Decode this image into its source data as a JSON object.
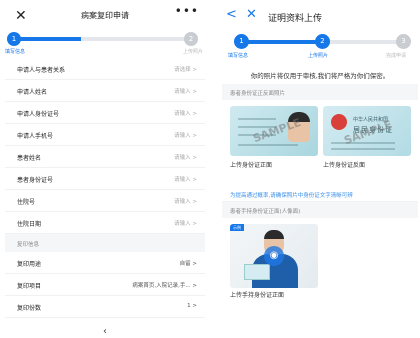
{
  "left": {
    "header": {
      "close": "✕",
      "title": "病案复印申请",
      "more": "•••"
    },
    "stepper": {
      "step1_num": "1",
      "step2_num": "2",
      "step1_label": "填写信息",
      "step2_label": "上传照片"
    },
    "rows": [
      {
        "label": "申请人与患者关系",
        "value": "请选择 >"
      },
      {
        "label": "申请人姓名",
        "value": "请输入 >"
      },
      {
        "label": "申请人身份证号",
        "value": "请输入 >"
      },
      {
        "label": "申请人手机号",
        "value": "请输入 >"
      },
      {
        "label": "患者姓名",
        "value": "请输入 >"
      },
      {
        "label": "患者身份证号",
        "value": "请输入 >"
      },
      {
        "label": "住院号",
        "value": "请输入 >"
      },
      {
        "label": "住院日期",
        "value": "请输入 >"
      }
    ],
    "section2_title": "复印信息",
    "rows2": [
      {
        "label": "复印用途",
        "value": "自留 >"
      },
      {
        "label": "复印项目",
        "value": "病案首页,入院记录,手... >"
      },
      {
        "label": "复印份数",
        "value": "1 >"
      }
    ],
    "bottom_glyph": "‹"
  },
  "right": {
    "header": {
      "back": "<",
      "close": "✕",
      "title": "证明资料上传"
    },
    "stepper": {
      "step1_num": "1",
      "step2_num": "2",
      "step3_num": "3",
      "step1_label": "填写信息",
      "step2_label": "上传照片",
      "step3_label": "完成申请"
    },
    "notice": "你的照片将仅用于审核,我们将严格为你们保密。",
    "section1_title": "患者身份证正反面照片",
    "id_front": {
      "stamp": "SAMPLE",
      "caption": "上传身份证正面"
    },
    "id_back": {
      "title": "中华人民共和国",
      "subtitle": "居民身份证",
      "stamp": "SAMPLE",
      "caption": "上传身份证反面"
    },
    "warning": "为提高通过概率,请确保照片中身份证文字清晰可辨",
    "section2_title": "患者手持身份证正面(人像面)",
    "hold": {
      "badge": "示例",
      "camera": "◉",
      "caption": "上传手持身份证正面"
    }
  },
  "colors": {
    "accent": "#1677e8",
    "inactive": "#c9ccd1",
    "track": "#e3e6ea"
  }
}
